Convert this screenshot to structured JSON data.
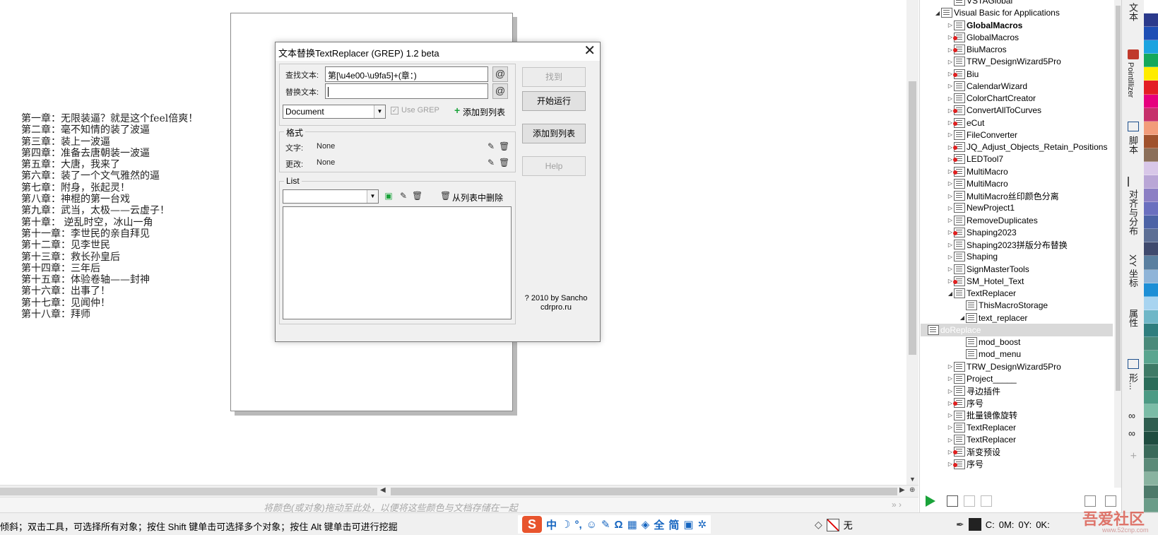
{
  "canvas": {
    "story_lines": [
      "第一章：无限装逼？就是这个feel倍爽！",
      "第二章：毫不知情的装了波逼",
      "第三章：装上一波逼",
      "第四章：准备去唐朝装一波逼",
      "第五章：大唐，我来了",
      "第六章：装了一个文气雅然的逼",
      "第七章：附身，张起灵！",
      "第八章：神棍的第一台戏",
      "第九章：武当，太极——云虚子！",
      "第十章： 逆乱时空，冰山一角",
      "第十一章：李世民的亲自拜见",
      "第十二章：见李世民",
      "第十三章：救长孙皇后",
      "第十四章：三年后",
      "第十五章：体验卷轴——封神",
      "第十六章：出事了！",
      "第十七章：见闻仲！",
      "第十八章：拜师"
    ]
  },
  "dialog": {
    "title": "文本替换TextReplacer (GREP) 1.2 beta",
    "close_glyph": "✕",
    "find_label": "查找文本:",
    "find_value": "第[\\u4e00-\\u9fa5]+(章：)",
    "replace_label": "替换文本:",
    "replace_value": "",
    "at_glyph": "@",
    "scope_value": "Document",
    "use_grep_label": "Use GREP",
    "add_to_list_link": "添加到列表",
    "format_group": "格式",
    "format_text_label": "文字:",
    "format_text_value": "None",
    "format_change_label": "更改:",
    "format_change_value": "None",
    "list_group": "List",
    "list_combo_value": "",
    "remove_from_list": "从列表中删除",
    "btn_find": "找到",
    "btn_run": "开始运行",
    "btn_add": "添加到列表",
    "btn_help": "Help",
    "credit_line1": "? 2010 by Sancho",
    "credit_line2": "cdrpro.ru"
  },
  "tree": {
    "rows": [
      {
        "label": "VSTAGlobal",
        "indent": 2,
        "expander": "",
        "locked": false,
        "bold": false
      },
      {
        "label": "Visual Basic for Applications",
        "indent": 1,
        "expander": "◢",
        "locked": false,
        "bold": false
      },
      {
        "label": "GlobalMacros",
        "indent": 2,
        "expander": "▷",
        "locked": false,
        "bold": true
      },
      {
        "label": "GlobalMacros",
        "indent": 2,
        "expander": "▷",
        "locked": true,
        "bold": false
      },
      {
        "label": "BiuMacros",
        "indent": 2,
        "expander": "▷",
        "locked": true,
        "bold": false
      },
      {
        "label": "TRW_DesignWizard5Pro",
        "indent": 2,
        "expander": "▷",
        "locked": false,
        "bold": false
      },
      {
        "label": "Biu",
        "indent": 2,
        "expander": "▷",
        "locked": true,
        "bold": false
      },
      {
        "label": "CalendarWizard",
        "indent": 2,
        "expander": "▷",
        "locked": false,
        "bold": false
      },
      {
        "label": "ColorChartCreator",
        "indent": 2,
        "expander": "▷",
        "locked": false,
        "bold": false
      },
      {
        "label": "ConvertAllToCurves",
        "indent": 2,
        "expander": "▷",
        "locked": true,
        "bold": false
      },
      {
        "label": "eCut",
        "indent": 2,
        "expander": "▷",
        "locked": true,
        "bold": false
      },
      {
        "label": "FileConverter",
        "indent": 2,
        "expander": "▷",
        "locked": false,
        "bold": false
      },
      {
        "label": "JQ_Adjust_Objects_Retain_Positions",
        "indent": 2,
        "expander": "▷",
        "locked": true,
        "bold": false
      },
      {
        "label": "LEDTool7",
        "indent": 2,
        "expander": "▷",
        "locked": true,
        "bold": false
      },
      {
        "label": "MultiMacro",
        "indent": 2,
        "expander": "▷",
        "locked": true,
        "bold": false
      },
      {
        "label": "MultiMacro",
        "indent": 2,
        "expander": "▷",
        "locked": false,
        "bold": false
      },
      {
        "label": "MultiMacro丝印颜色分离",
        "indent": 2,
        "expander": "▷",
        "locked": false,
        "bold": false
      },
      {
        "label": "NewProject1",
        "indent": 2,
        "expander": "▷",
        "locked": false,
        "bold": false
      },
      {
        "label": "RemoveDuplicates",
        "indent": 2,
        "expander": "▷",
        "locked": false,
        "bold": false
      },
      {
        "label": "Shaping2023",
        "indent": 2,
        "expander": "▷",
        "locked": true,
        "bold": false
      },
      {
        "label": "Shaping2023拼版分布替换",
        "indent": 2,
        "expander": "▷",
        "locked": false,
        "bold": false
      },
      {
        "label": "Shaping",
        "indent": 2,
        "expander": "▷",
        "locked": false,
        "bold": false
      },
      {
        "label": "SignMasterTools",
        "indent": 2,
        "expander": "▷",
        "locked": false,
        "bold": false
      },
      {
        "label": "SM_Hotel_Text",
        "indent": 2,
        "expander": "▷",
        "locked": true,
        "bold": false
      },
      {
        "label": "TextReplacer",
        "indent": 2,
        "expander": "◢",
        "locked": false,
        "bold": false
      },
      {
        "label": "ThisMacroStorage",
        "indent": 3,
        "expander": "",
        "locked": false,
        "bold": false
      },
      {
        "label": "text_replacer",
        "indent": 3,
        "expander": "◢",
        "locked": false,
        "bold": false
      },
      {
        "label": "doReplace",
        "indent": 4,
        "expander": "",
        "locked": false,
        "bold": false,
        "selected": true
      },
      {
        "label": "mod_boost",
        "indent": 3,
        "expander": "",
        "locked": false,
        "bold": false
      },
      {
        "label": "mod_menu",
        "indent": 3,
        "expander": "",
        "locked": false,
        "bold": false
      },
      {
        "label": "TRW_DesignWizard5Pro",
        "indent": 2,
        "expander": "▷",
        "locked": false,
        "bold": false
      },
      {
        "label": "Project_____",
        "indent": 2,
        "expander": "▷",
        "locked": false,
        "bold": false
      },
      {
        "label": "寻边插件",
        "indent": 2,
        "expander": "▷",
        "locked": false,
        "bold": false
      },
      {
        "label": "序号",
        "indent": 2,
        "expander": "▷",
        "locked": true,
        "bold": false
      },
      {
        "label": "批量镜像旋转",
        "indent": 2,
        "expander": "▷",
        "locked": false,
        "bold": false
      },
      {
        "label": "TextReplacer",
        "indent": 2,
        "expander": "▷",
        "locked": false,
        "bold": false
      },
      {
        "label": "TextReplacer",
        "indent": 2,
        "expander": "▷",
        "locked": false,
        "bold": false
      },
      {
        "label": "渐变预设",
        "indent": 2,
        "expander": "▷",
        "locked": true,
        "bold": false
      },
      {
        "label": "序号",
        "indent": 2,
        "expander": "▷",
        "locked": true,
        "bold": false
      }
    ]
  },
  "dockers": {
    "tab_text": "文本",
    "tab_pointillizer": "Pointillizer",
    "tab_script": "脚本",
    "tab_align": "对齐与分布",
    "tab_coords": "XY 坐标",
    "tab_props": "属性",
    "tab_more": "形..."
  },
  "palette": [
    "#ffffff",
    "#2b3a8c",
    "#1e4fb5",
    "#1ba3e0",
    "#14a85a",
    "#ffec00",
    "#e31e24",
    "#e6007e",
    "#c6306b",
    "#f29c7a",
    "#a0522d",
    "#8b6f5a",
    "#d8c7e8",
    "#b9a6d6",
    "#8c7fc4",
    "#6a6fbf",
    "#4c63a6",
    "#5d6f95",
    "#3f4a6e",
    "#5a7fa0",
    "#8fb4d8",
    "#1d8fd6",
    "#a8d4f0",
    "#6fb7c7",
    "#2f7e7e",
    "#4a8a7a",
    "#5aa58f",
    "#3e7a66",
    "#2b6d5a",
    "#4c9a84",
    "#7bbca6",
    "#2f5e50",
    "#1f4d40",
    "#3a6a5a",
    "#5b8a78",
    "#89b3a0",
    "#4d7a6a",
    "#6a9c88"
  ],
  "colorbar": {
    "hint": "将颜色(或对象)拖动至此处，以便将这些颜色与文档存储在一起"
  },
  "status": {
    "message": "倾斜；双击工具，可选择所有对象；按住 Shift 键单击可选择多个对象；按住 Alt 键单击可进行挖掘",
    "ime_logo": "S",
    "ime_items": [
      "中",
      "☽",
      "°,",
      "☺",
      "✎",
      "Ω",
      "▦",
      "◈",
      "全",
      "简",
      "▣",
      "✲"
    ],
    "fill_none": "无",
    "coord_c": "C:",
    "coord_m": "0M:",
    "coord_y": "0Y:",
    "coord_k": "0K:"
  },
  "watermark": {
    "text": "吾爱社区",
    "url": "www.52cnp.com"
  }
}
